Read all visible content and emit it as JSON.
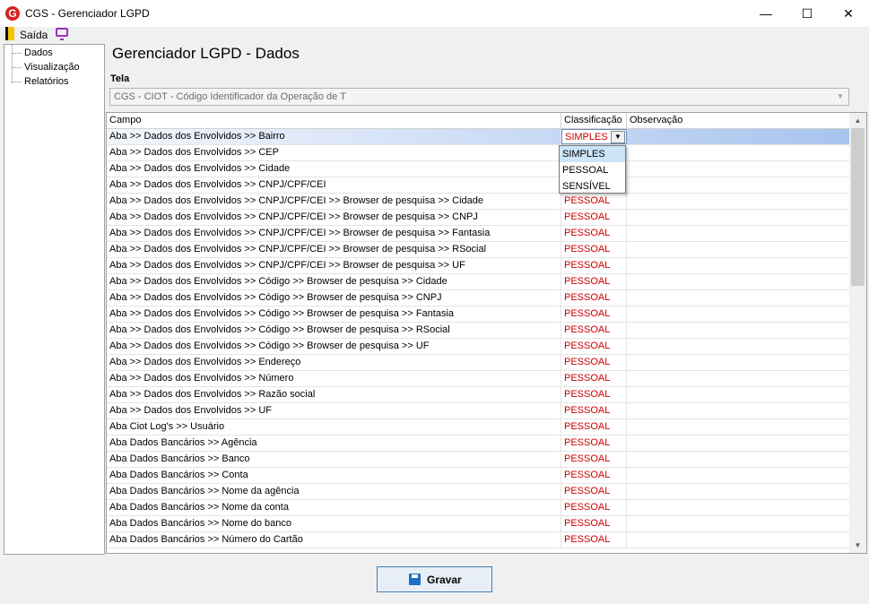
{
  "window": {
    "title": "CGS - Gerenciador LGPD",
    "app_icon_letter": "G",
    "app_icon_color": "#d92020",
    "minimize": "—",
    "maximize": "☐",
    "close": "✕"
  },
  "menubar": {
    "exit_label": "Saída"
  },
  "nav": {
    "items": [
      "Dados",
      "Visualização",
      "Relatórios"
    ]
  },
  "page": {
    "title": "Gerenciador LGPD - Dados"
  },
  "tela": {
    "label": "Tela",
    "value": "CGS - CIOT - Código Identificador da Operação de T"
  },
  "grid": {
    "columns": [
      "Campo",
      "Classificação",
      "Observação"
    ],
    "rows": [
      {
        "campo": "Aba >> Dados dos Envolvidos >> Bairro",
        "classificacao": "SIMPLES",
        "observacao": ""
      },
      {
        "campo": "Aba >> Dados dos Envolvidos >> CEP",
        "classificacao": "",
        "observacao": ""
      },
      {
        "campo": "Aba >> Dados dos Envolvidos >> Cidade",
        "classificacao": "",
        "observacao": ""
      },
      {
        "campo": "Aba >> Dados dos Envolvidos >> CNPJ/CPF/CEI",
        "classificacao": "",
        "observacao": ""
      },
      {
        "campo": "Aba >> Dados dos Envolvidos >> CNPJ/CPF/CEI >> Browser de pesquisa >> Cidade",
        "classificacao": "PESSOAL",
        "observacao": ""
      },
      {
        "campo": "Aba >> Dados dos Envolvidos >> CNPJ/CPF/CEI >> Browser de pesquisa >> CNPJ",
        "classificacao": "PESSOAL",
        "observacao": ""
      },
      {
        "campo": "Aba >> Dados dos Envolvidos >> CNPJ/CPF/CEI >> Browser de pesquisa >> Fantasia",
        "classificacao": "PESSOAL",
        "observacao": ""
      },
      {
        "campo": "Aba >> Dados dos Envolvidos >> CNPJ/CPF/CEI >> Browser de pesquisa >> RSocial",
        "classificacao": "PESSOAL",
        "observacao": ""
      },
      {
        "campo": "Aba >> Dados dos Envolvidos >> CNPJ/CPF/CEI >> Browser de pesquisa >> UF",
        "classificacao": "PESSOAL",
        "observacao": ""
      },
      {
        "campo": "Aba >> Dados dos Envolvidos >> Código >> Browser de pesquisa >> Cidade",
        "classificacao": "PESSOAL",
        "observacao": ""
      },
      {
        "campo": "Aba >> Dados dos Envolvidos >> Código >> Browser de pesquisa >> CNPJ",
        "classificacao": "PESSOAL",
        "observacao": ""
      },
      {
        "campo": "Aba >> Dados dos Envolvidos >> Código >> Browser de pesquisa >> Fantasia",
        "classificacao": "PESSOAL",
        "observacao": ""
      },
      {
        "campo": "Aba >> Dados dos Envolvidos >> Código >> Browser de pesquisa >> RSocial",
        "classificacao": "PESSOAL",
        "observacao": ""
      },
      {
        "campo": "Aba >> Dados dos Envolvidos >> Código >> Browser de pesquisa >> UF",
        "classificacao": "PESSOAL",
        "observacao": ""
      },
      {
        "campo": "Aba >> Dados dos Envolvidos >> Endereço",
        "classificacao": "PESSOAL",
        "observacao": ""
      },
      {
        "campo": "Aba >> Dados dos Envolvidos >> Número",
        "classificacao": "PESSOAL",
        "observacao": ""
      },
      {
        "campo": "Aba >> Dados dos Envolvidos >> Razão social",
        "classificacao": "PESSOAL",
        "observacao": ""
      },
      {
        "campo": "Aba >> Dados dos Envolvidos >> UF",
        "classificacao": "PESSOAL",
        "observacao": ""
      },
      {
        "campo": "Aba Ciot Log's >> Usuário",
        "classificacao": "PESSOAL",
        "observacao": ""
      },
      {
        "campo": "Aba Dados Bancários >> Agência",
        "classificacao": "PESSOAL",
        "observacao": ""
      },
      {
        "campo": "Aba Dados Bancários >> Banco",
        "classificacao": "PESSOAL",
        "observacao": ""
      },
      {
        "campo": "Aba Dados Bancários >> Conta",
        "classificacao": "PESSOAL",
        "observacao": ""
      },
      {
        "campo": "Aba Dados Bancários >> Nome da agência",
        "classificacao": "PESSOAL",
        "observacao": ""
      },
      {
        "campo": "Aba Dados Bancários >> Nome da conta",
        "classificacao": "PESSOAL",
        "observacao": ""
      },
      {
        "campo": "Aba Dados Bancários >> Nome do banco",
        "classificacao": "PESSOAL",
        "observacao": ""
      },
      {
        "campo": "Aba Dados Bancários >> Número do Cartão",
        "classificacao": "PESSOAL",
        "observacao": ""
      }
    ],
    "dropdown_options": [
      "SIMPLES",
      "PESSOAL",
      "SENSÍVEL"
    ],
    "dropdown_highlighted": "SIMPLES"
  },
  "colors": {
    "classification_text": "#cc0000",
    "selection": "#a8c4ee",
    "accent": "#3c7fb1"
  },
  "icons": {
    "exit": "exit-door-icon",
    "monitor": "monitor-icon",
    "save": "floppy-disk-icon"
  },
  "actions": {
    "save_label": "Gravar"
  }
}
